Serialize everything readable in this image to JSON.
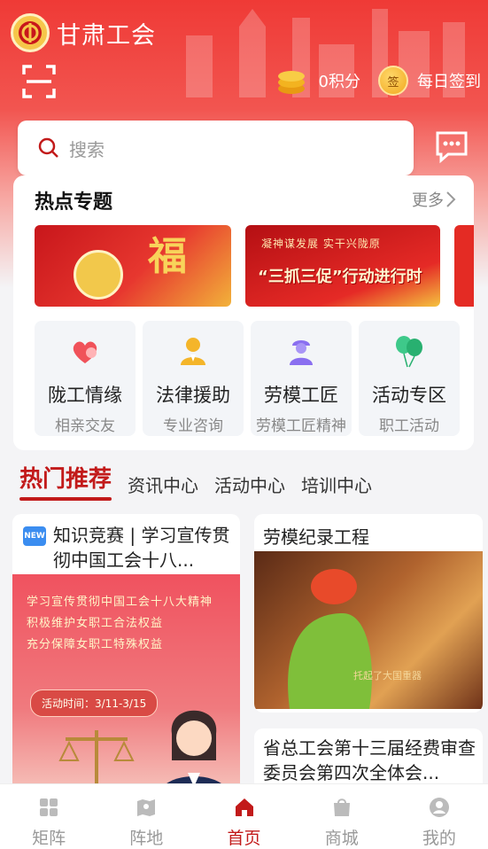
{
  "header": {
    "app_title": "甘肃工会",
    "points_label": "0积分",
    "sign_coin_char": "签",
    "daily_signin": "每日签到"
  },
  "search": {
    "placeholder": "搜索"
  },
  "hot_topics": {
    "title": "热点专题",
    "more": "更多",
    "banner2_top": "凝神谋发展 实干兴陇原",
    "banner2_main": "“三抓三促”行动进行时",
    "banner1_big": "福"
  },
  "services": [
    {
      "name": "陇工情缘",
      "sub": "相亲交友",
      "icon": "heart-icon"
    },
    {
      "name": "法律援助",
      "sub": "专业咨询",
      "icon": "lawyer-icon"
    },
    {
      "name": "劳模工匠",
      "sub": "劳模工匠精神",
      "icon": "worker-icon"
    },
    {
      "name": "活动专区",
      "sub": "职工活动",
      "icon": "balloon-icon"
    }
  ],
  "tabs": [
    {
      "label": "热门推荐",
      "active": true
    },
    {
      "label": "资讯中心",
      "active": false
    },
    {
      "label": "活动中心",
      "active": false
    },
    {
      "label": "培训中心",
      "active": false
    }
  ],
  "feed": {
    "left": {
      "badge": "NEW",
      "title": "知识竞赛 | 学习宣传贯彻中国工会十八...",
      "poster_lines": [
        "学习宣传贯彻中国工会十八大精神",
        "积极维护女职工合法权益",
        "充分保障女职工特殊权益"
      ],
      "poster_time": "活动时间：3/11-3/15"
    },
    "right1": {
      "title": "劳模纪录工程",
      "caption": "托起了大国重器"
    },
    "right2": {
      "title": "省总工会第十三届经费审查委员会第四次全体会..."
    }
  },
  "bottom_nav": [
    {
      "label": "矩阵",
      "icon": "grid-icon",
      "active": false
    },
    {
      "label": "阵地",
      "icon": "map-icon",
      "active": false
    },
    {
      "label": "首页",
      "icon": "home-icon",
      "active": true
    },
    {
      "label": "商城",
      "icon": "shop-icon",
      "active": false
    },
    {
      "label": "我的",
      "icon": "user-icon",
      "active": false
    }
  ],
  "colors": {
    "brand_red": "#c21a1a",
    "header_red": "#ef3a36",
    "gold": "#f1a81e"
  }
}
